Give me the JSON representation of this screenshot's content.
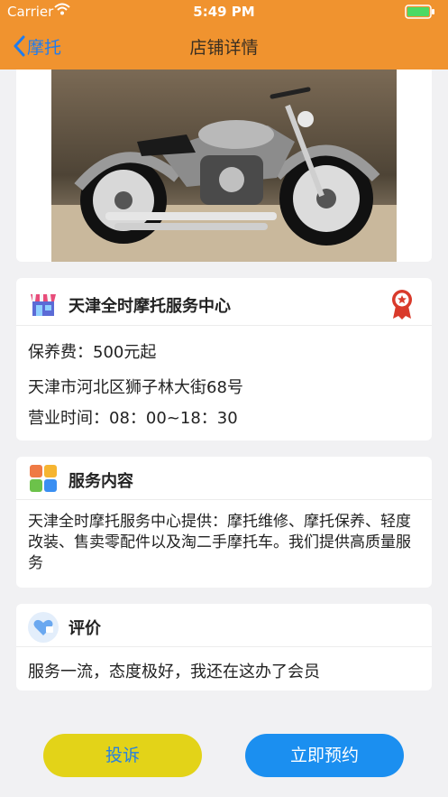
{
  "status_bar": {
    "carrier": "Carrier",
    "time": "5:49 PM"
  },
  "nav": {
    "back_label": "摩托",
    "title": "店铺详情"
  },
  "shop": {
    "name": "天津全时摩托服务中心",
    "fee": "保养费：500元起",
    "address": "天津市河北区狮子林大街68号",
    "hours": "营业时间：08：00~18：30"
  },
  "service": {
    "title": "服务内容",
    "description": "天津全时摩托服务中心提供：摩托维修、摩托保养、轻度改装、售卖零配件以及淘二手摩托车。我们提供高质量服务"
  },
  "review": {
    "title": "评价",
    "text": "服务一流，态度极好，我还在这办了会员"
  },
  "buttons": {
    "complain": "投诉",
    "book": "立即预约"
  },
  "colors": {
    "header": "#f0932f",
    "back_link": "#1e7cf0",
    "complain_button": "#e3d318",
    "book_button": "#1b8ff0"
  },
  "icons": [
    "wifi-icon",
    "battery-icon",
    "back-chevron-icon",
    "shop-icon",
    "award-badge-icon",
    "service-grid-icon",
    "review-heart-icon"
  ]
}
